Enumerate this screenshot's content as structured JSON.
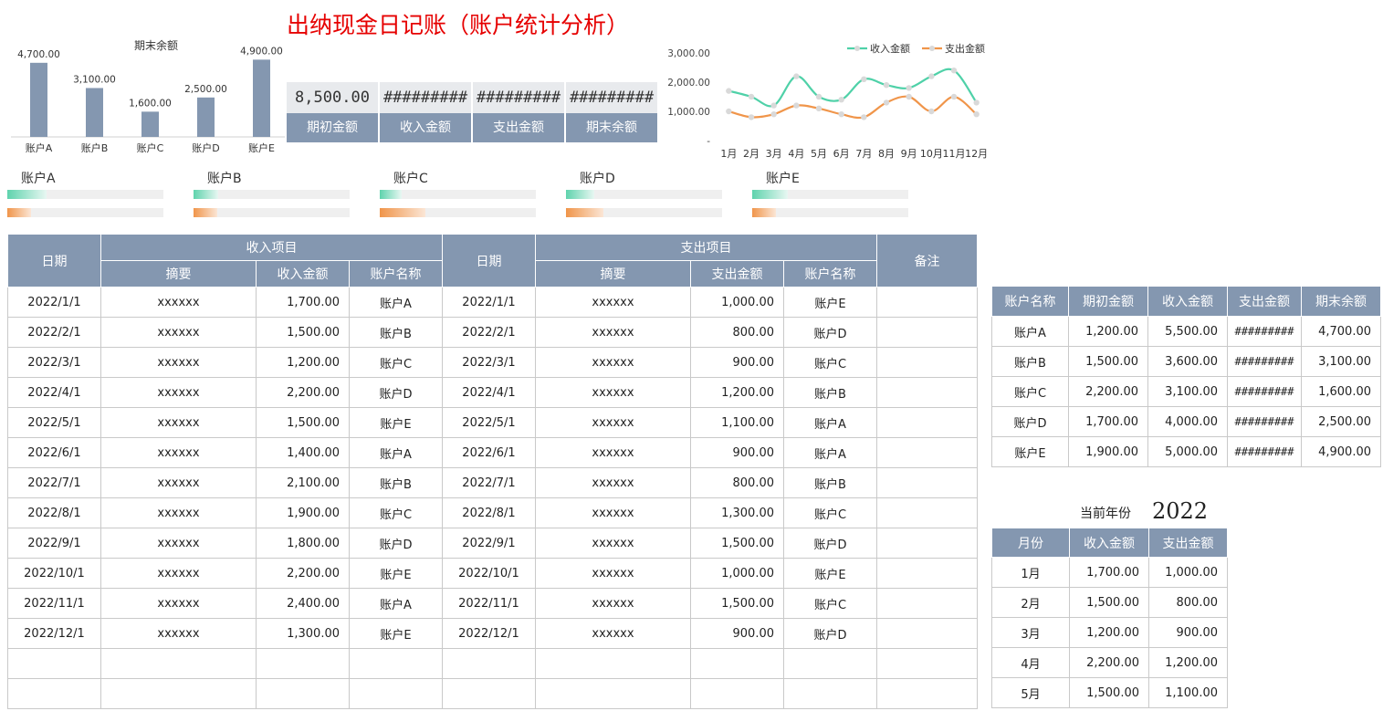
{
  "title": "出纳现金日记账（账户统计分析）",
  "bar_chart": {
    "chart_data": {
      "type": "bar",
      "title": "期末余额",
      "categories": [
        "账户A",
        "账户B",
        "账户C",
        "账户D",
        "账户E"
      ],
      "values": [
        4700,
        3100,
        1600,
        2500,
        4900
      ],
      "labels": [
        "4,700.00",
        "3,100.00",
        "1,600.00",
        "2,500.00",
        "4,900.00"
      ],
      "ylim": [
        0,
        5500
      ],
      "color": "#8497b0"
    }
  },
  "summary": {
    "values": [
      "8,500.00",
      "#########",
      "#########",
      "#########"
    ],
    "labels": [
      "期初金额",
      "收入金额",
      "支出金额",
      "期末余额"
    ]
  },
  "line_chart": {
    "chart_data": {
      "type": "line",
      "categories": [
        "1月",
        "2月",
        "3月",
        "4月",
        "5月",
        "6月",
        "7月",
        "8月",
        "9月",
        "10月",
        "11月",
        "12月"
      ],
      "y_ticks": [
        "3,000.00",
        "2,000.00",
        "1,000.00",
        "-"
      ],
      "ylim": [
        0,
        3000
      ],
      "series": [
        {
          "name": "收入金额",
          "color": "#4fd1a8",
          "values": [
            1700,
            1500,
            1200,
            2200,
            1500,
            1400,
            2100,
            1900,
            1800,
            2200,
            2400,
            1300
          ]
        },
        {
          "name": "支出金额",
          "color": "#f0954a",
          "values": [
            1000,
            800,
            900,
            1200,
            1100,
            900,
            800,
            1300,
            1500,
            1000,
            1500,
            900
          ]
        }
      ],
      "legend": "top-right"
    }
  },
  "progress": [
    {
      "name": "账户A",
      "income": 0.25,
      "expense": 0.15
    },
    {
      "name": "账户B",
      "income": 0.16,
      "expense": 0.15
    },
    {
      "name": "账户C",
      "income": 0.14,
      "expense": 0.29
    },
    {
      "name": "账户D",
      "income": 0.18,
      "expense": 0.24
    },
    {
      "name": "账户E",
      "income": 0.23,
      "expense": 0.15
    }
  ],
  "ledger": {
    "headers": {
      "date": "日期",
      "income_group": "收入项目",
      "expense_group": "支出项目",
      "note": "备注",
      "summary": "摘要",
      "income_amount": "收入金额",
      "expense_amount": "支出金额",
      "account": "账户名称"
    },
    "rows": [
      [
        "2022/1/1",
        "xxxxxx",
        "1,700.00",
        "账户A",
        "2022/1/1",
        "xxxxxx",
        "1,000.00",
        "账户E"
      ],
      [
        "2022/2/1",
        "xxxxxx",
        "1,500.00",
        "账户B",
        "2022/2/1",
        "xxxxxx",
        "800.00",
        "账户D"
      ],
      [
        "2022/3/1",
        "xxxxxx",
        "1,200.00",
        "账户C",
        "2022/3/1",
        "xxxxxx",
        "900.00",
        "账户C"
      ],
      [
        "2022/4/1",
        "xxxxxx",
        "2,200.00",
        "账户D",
        "2022/4/1",
        "xxxxxx",
        "1,200.00",
        "账户B"
      ],
      [
        "2022/5/1",
        "xxxxxx",
        "1,500.00",
        "账户E",
        "2022/5/1",
        "xxxxxx",
        "1,100.00",
        "账户A"
      ],
      [
        "2022/6/1",
        "xxxxxx",
        "1,400.00",
        "账户A",
        "2022/6/1",
        "xxxxxx",
        "900.00",
        "账户A"
      ],
      [
        "2022/7/1",
        "xxxxxx",
        "2,100.00",
        "账户B",
        "2022/7/1",
        "xxxxxx",
        "800.00",
        "账户B"
      ],
      [
        "2022/8/1",
        "xxxxxx",
        "1,900.00",
        "账户C",
        "2022/8/1",
        "xxxxxx",
        "1,300.00",
        "账户C"
      ],
      [
        "2022/9/1",
        "xxxxxx",
        "1,800.00",
        "账户D",
        "2022/9/1",
        "xxxxxx",
        "1,500.00",
        "账户D"
      ],
      [
        "2022/10/1",
        "xxxxxx",
        "2,200.00",
        "账户E",
        "2022/10/1",
        "xxxxxx",
        "1,000.00",
        "账户E"
      ],
      [
        "2022/11/1",
        "xxxxxx",
        "2,400.00",
        "账户A",
        "2022/11/1",
        "xxxxxx",
        "1,500.00",
        "账户C"
      ],
      [
        "2022/12/1",
        "xxxxxx",
        "1,300.00",
        "账户E",
        "2022/12/1",
        "xxxxxx",
        "900.00",
        "账户D"
      ],
      [
        "",
        "",
        "",
        "",
        "",
        "",
        "",
        ""
      ],
      [
        "",
        "",
        "",
        "",
        "",
        "",
        "",
        ""
      ]
    ]
  },
  "accounts": {
    "headers": [
      "账户名称",
      "期初金额",
      "收入金额",
      "支出金额",
      "期末余额"
    ],
    "rows": [
      [
        "账户A",
        "1,200.00",
        "5,500.00",
        "#########",
        "4,700.00"
      ],
      [
        "账户B",
        "1,500.00",
        "3,600.00",
        "#########",
        "3,100.00"
      ],
      [
        "账户C",
        "2,200.00",
        "3,100.00",
        "#########",
        "1,600.00"
      ],
      [
        "账户D",
        "1,700.00",
        "4,000.00",
        "#########",
        "2,500.00"
      ],
      [
        "账户E",
        "1,900.00",
        "5,000.00",
        "#########",
        "4,900.00"
      ]
    ]
  },
  "current_year": {
    "label": "当前年份",
    "value": "2022"
  },
  "monthly": {
    "headers": [
      "月份",
      "收入金额",
      "支出金额"
    ],
    "rows": [
      [
        "1月",
        "1,700.00",
        "1,000.00"
      ],
      [
        "2月",
        "1,500.00",
        "800.00"
      ],
      [
        "3月",
        "1,200.00",
        "900.00"
      ],
      [
        "4月",
        "2,200.00",
        "1,200.00"
      ],
      [
        "5月",
        "1,500.00",
        "1,100.00"
      ]
    ]
  }
}
